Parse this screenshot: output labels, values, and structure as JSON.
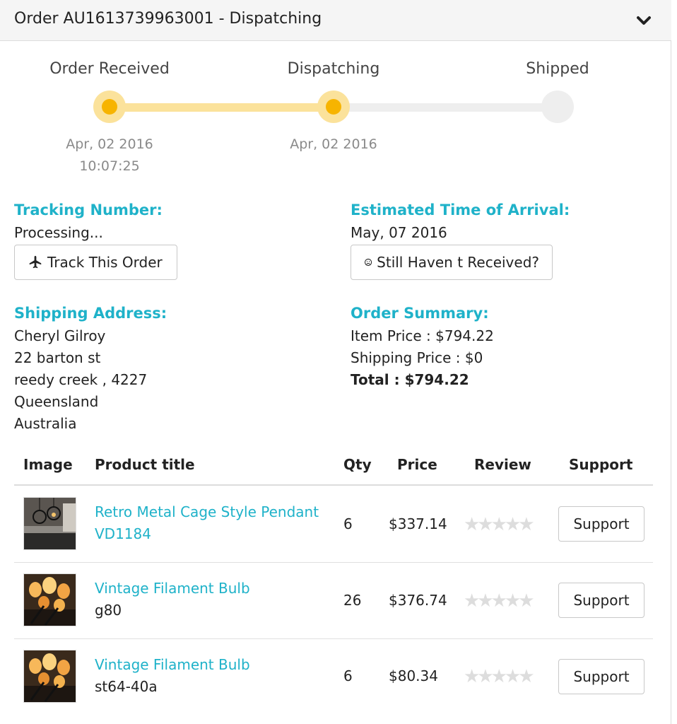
{
  "header": {
    "title": "Order AU1613739963001 - Dispatching",
    "toggle_icon": "chevron-down-icon"
  },
  "progress": {
    "steps": [
      {
        "label": "Order Received",
        "date_line1": "Apr, 02 2016",
        "date_line2": "10:07:25",
        "state": "done"
      },
      {
        "label": "Dispatching",
        "date_line1": "Apr, 02 2016",
        "date_line2": "",
        "state": "done"
      },
      {
        "label": "Shipped",
        "date_line1": "",
        "date_line2": "",
        "state": "pending"
      }
    ],
    "completed_fraction": 0.5,
    "colors": {
      "done": "#f7b400",
      "done_ring": "#fbe29b",
      "pending": "#eeeeee"
    }
  },
  "tracking": {
    "heading": "Tracking Number:",
    "value": "Processing...",
    "button_label": "Track This Order",
    "button_icon": "airplane-icon"
  },
  "eta": {
    "heading": "Estimated Time of Arrival:",
    "value": "May, 07 2016",
    "button_label": "Still Haven t Received?",
    "button_icon": "frown-face-icon"
  },
  "shipping": {
    "heading": "Shipping Address:",
    "name": "Cheryl Gilroy",
    "street": "22 barton st",
    "city": "reedy creek , 4227",
    "state": "Queensland",
    "country": "Australia"
  },
  "summary": {
    "heading": "Order Summary:",
    "item_price": "Item Price : $794.22",
    "shipping_price": "Shipping Price : $0",
    "total": "Total : $794.22"
  },
  "table": {
    "headers": {
      "image": "Image",
      "title": "Product title",
      "qty": "Qty",
      "price": "Price",
      "review": "Review",
      "support": "Support"
    },
    "rows": [
      {
        "title_line1": "Retro Metal Cage Style Pendant",
        "title_line2": "VD1184",
        "subtitle": "",
        "qty": "6",
        "price": "$337.14",
        "stars": "★★★★★",
        "rating": 0,
        "support_label": "Support",
        "image": "pendant-lamp-photo"
      },
      {
        "title_line1": "Vintage Filament Bulb",
        "title_line2": "",
        "subtitle": "g80",
        "qty": "26",
        "price": "$376.74",
        "stars": "★★★★★",
        "rating": 0,
        "support_label": "Support",
        "image": "filament-bulbs-photo"
      },
      {
        "title_line1": "Vintage Filament Bulb",
        "title_line2": "",
        "subtitle": "st64-40a",
        "qty": "6",
        "price": "$80.34",
        "stars": "★★★★★",
        "rating": 0,
        "support_label": "Support",
        "image": "filament-bulbs-photo"
      }
    ]
  },
  "colors": {
    "accent": "#1fb2c9",
    "header_bg": "#f5f5f5"
  }
}
